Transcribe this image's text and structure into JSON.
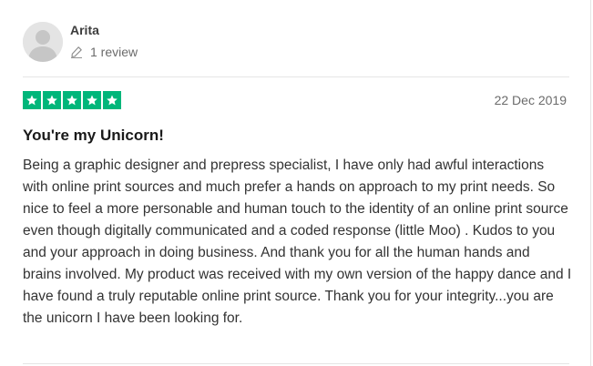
{
  "reviewer": {
    "name": "Arita",
    "review_count": "1 review",
    "avatar_icon": "user-silhouette-icon",
    "review_count_icon": "pencil-icon"
  },
  "review": {
    "rating": 5,
    "rating_max": 5,
    "star_color": "#00b67a",
    "date": "22 Dec 2019",
    "title": "You're my Unicorn!",
    "body": "Being a graphic designer and prepress specialist, I have only had awful interactions with online print sources and much prefer a hands on approach to my print needs. So nice to feel a more personable and human touch to the identity of an online print source even though digitally communicated and a coded response (little Moo) . Kudos to you and your approach in doing business. And thank you for all the human hands and brains involved. My product was received with my own version of the happy dance and I have found a truly reputable online print source. Thank you for your integrity...you are the unicorn I have been looking for."
  }
}
